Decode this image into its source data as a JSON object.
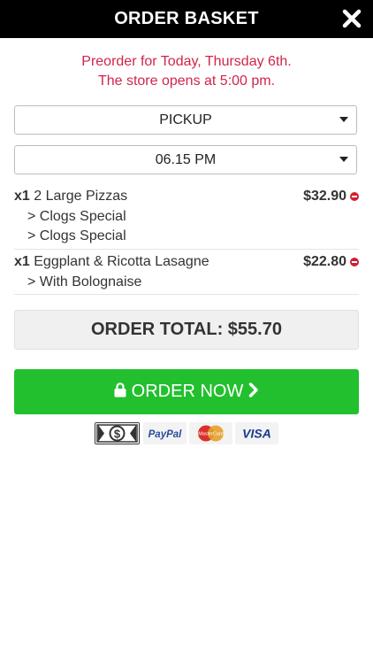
{
  "header": {
    "title": "ORDER BASKET",
    "close_icon": "close-icon"
  },
  "notice": {
    "line1": "Preorder for Today, Thursday 6th.",
    "line2": "The store opens at 5:00 pm."
  },
  "order_type": {
    "value": "PICKUP"
  },
  "order_time": {
    "value": "06.15 PM"
  },
  "items": [
    {
      "qty": "x1",
      "name": "2 Large Pizzas",
      "price": "$32.90",
      "options": [
        "> Clogs Special",
        "> Clogs Special"
      ]
    },
    {
      "qty": "x1",
      "name": "Eggplant & Ricotta Lasagne",
      "price": "$22.80",
      "options": [
        "> With Bolognaise"
      ]
    }
  ],
  "total": {
    "label": "ORDER TOTAL: $55.70"
  },
  "order_button": {
    "label": "ORDER NOW"
  },
  "payments": {
    "paypal": "PayPal",
    "mastercard": "MasterCard",
    "visa": "VISA",
    "cash_symbol": "$"
  },
  "colors": {
    "notice": "#d0254a",
    "button": "#22c02e",
    "remove": "#d21f2e"
  }
}
